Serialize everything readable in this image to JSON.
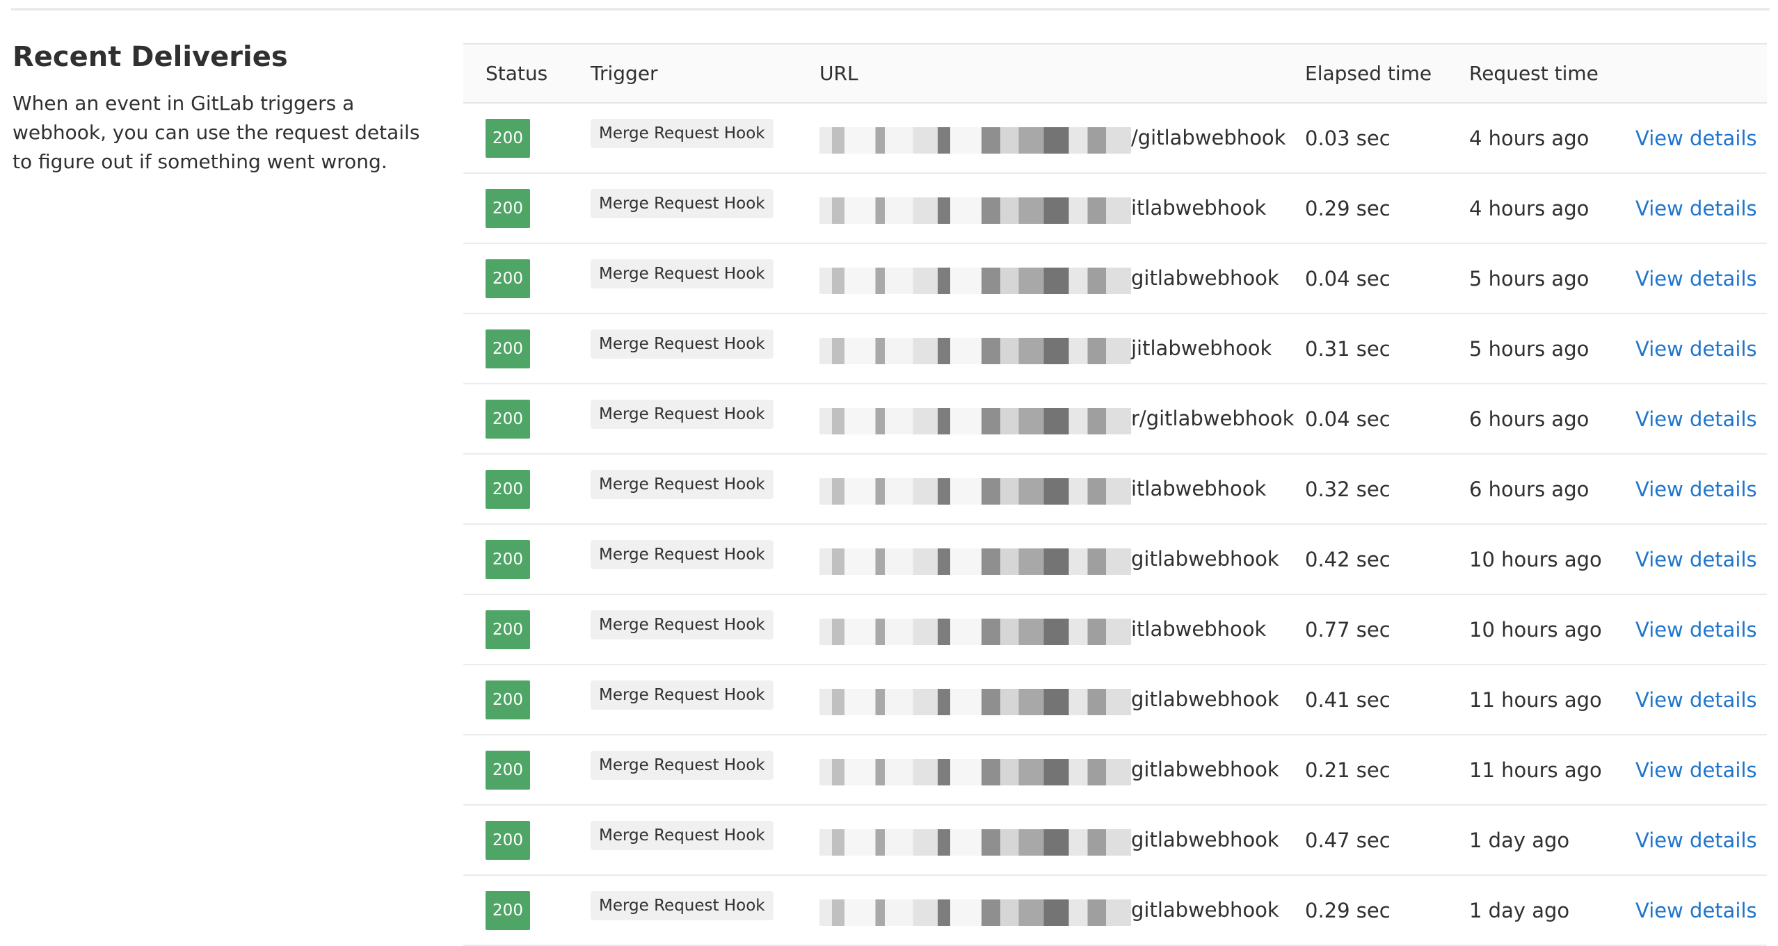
{
  "section": {
    "title": "Recent Deliveries",
    "description": "When an event in GitLab triggers a webhook, you can use the request details to figure out if something went wrong."
  },
  "table": {
    "headers": {
      "status": "Status",
      "trigger": "Trigger",
      "url": "URL",
      "elapsed": "Elapsed time",
      "request": "Request time"
    },
    "rows": [
      {
        "status": "200",
        "trigger": "Merge Request Hook",
        "url_suffix": "/gitlabwebhook",
        "elapsed": "0.03 sec",
        "request_time": "4 hours ago",
        "action": "View details"
      },
      {
        "status": "200",
        "trigger": "Merge Request Hook",
        "url_suffix": "itlabwebhook",
        "elapsed": "0.29 sec",
        "request_time": "4 hours ago",
        "action": "View details"
      },
      {
        "status": "200",
        "trigger": "Merge Request Hook",
        "url_suffix": "gitlabwebhook",
        "elapsed": "0.04 sec",
        "request_time": "5 hours ago",
        "action": "View details"
      },
      {
        "status": "200",
        "trigger": "Merge Request Hook",
        "url_suffix": "jitlabwebhook",
        "elapsed": "0.31 sec",
        "request_time": "5 hours ago",
        "action": "View details"
      },
      {
        "status": "200",
        "trigger": "Merge Request Hook",
        "url_suffix": "r/gitlabwebhook",
        "elapsed": "0.04 sec",
        "request_time": "6 hours ago",
        "action": "View details"
      },
      {
        "status": "200",
        "trigger": "Merge Request Hook",
        "url_suffix": "itlabwebhook",
        "elapsed": "0.32 sec",
        "request_time": "6 hours ago",
        "action": "View details"
      },
      {
        "status": "200",
        "trigger": "Merge Request Hook",
        "url_suffix": "gitlabwebhook",
        "elapsed": "0.42 sec",
        "request_time": "10 hours ago",
        "action": "View details"
      },
      {
        "status": "200",
        "trigger": "Merge Request Hook",
        "url_suffix": "itlabwebhook",
        "elapsed": "0.77 sec",
        "request_time": "10 hours ago",
        "action": "View details"
      },
      {
        "status": "200",
        "trigger": "Merge Request Hook",
        "url_suffix": "gitlabwebhook",
        "elapsed": "0.41 sec",
        "request_time": "11 hours ago",
        "action": "View details"
      },
      {
        "status": "200",
        "trigger": "Merge Request Hook",
        "url_suffix": "gitlabwebhook",
        "elapsed": "0.21 sec",
        "request_time": "11 hours ago",
        "action": "View details"
      },
      {
        "status": "200",
        "trigger": "Merge Request Hook",
        "url_suffix": "gitlabwebhook",
        "elapsed": "0.47 sec",
        "request_time": "1 day ago",
        "action": "View details"
      },
      {
        "status": "200",
        "trigger": "Merge Request Hook",
        "url_suffix": "gitlabwebhook",
        "elapsed": "0.29 sec",
        "request_time": "1 day ago",
        "action": "View details"
      }
    ]
  },
  "colors": {
    "success_badge": "#4ea565",
    "link": "#1f75cb",
    "text": "#303030",
    "header_bg": "#fafafa",
    "border": "#e6e6e6"
  }
}
